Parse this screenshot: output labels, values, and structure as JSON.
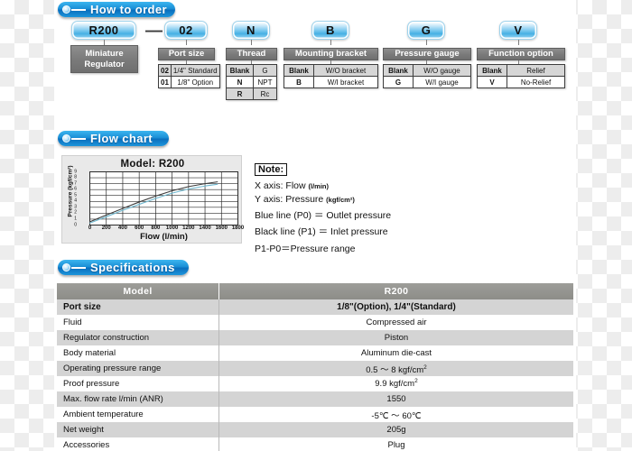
{
  "sections": {
    "how_to_order": "How to order",
    "flow_chart": "Flow chart",
    "specifications": "Specifications"
  },
  "order_code": {
    "pills": [
      {
        "label": "R200"
      },
      {
        "label": "02"
      },
      {
        "label": "N"
      },
      {
        "label": "B"
      },
      {
        "label": "G"
      },
      {
        "label": "V"
      }
    ],
    "separator": "—",
    "model_box": "Miniature\nRegulator",
    "model_box_line1": "Miniature",
    "model_box_line2": "Regulator",
    "groups": [
      {
        "title": "Port size",
        "rows": [
          {
            "code": "02",
            "desc": "1/4\" Standard"
          },
          {
            "code": "01",
            "desc": "1/8\" Option"
          }
        ]
      },
      {
        "title": "Thread",
        "rows": [
          {
            "code": "Blank",
            "desc": "G"
          },
          {
            "code": "N",
            "desc": "NPT"
          },
          {
            "code": "R",
            "desc": "Rc"
          }
        ]
      },
      {
        "title": "Mounting bracket",
        "rows": [
          {
            "code": "Blank",
            "desc": "W/O bracket"
          },
          {
            "code": "B",
            "desc": "W/I bracket"
          }
        ]
      },
      {
        "title": "Pressure gauge",
        "rows": [
          {
            "code": "Blank",
            "desc": "W/O gauge"
          },
          {
            "code": "G",
            "desc": "W/I gauge"
          }
        ]
      },
      {
        "title": "Function option",
        "rows": [
          {
            "code": "Blank",
            "desc": "Relief"
          },
          {
            "code": "V",
            "desc": "No-Relief"
          }
        ]
      }
    ]
  },
  "note": {
    "title": "Note:",
    "lines": [
      {
        "text": "X axis: Flow ",
        "unit": "(l/min)"
      },
      {
        "text": "Y axis: Pressure ",
        "unit": "(kgf/cm²)"
      },
      {
        "text": "Blue line (P0) ＝ Outlet pressure",
        "unit": ""
      },
      {
        "text": "Black line (P1) ＝ Inlet pressure",
        "unit": ""
      },
      {
        "text": "P1-P0＝Pressure range",
        "unit": ""
      }
    ]
  },
  "chart_data": {
    "type": "line",
    "title": "Model: R200",
    "xlabel": "Flow (l/min)",
    "ylabel": "Pressure (kgf/cm²)",
    "xlim": [
      0,
      1800
    ],
    "ylim": [
      0,
      9
    ],
    "xticks": [
      0,
      200,
      400,
      600,
      800,
      1000,
      1200,
      1400,
      1600,
      1800
    ],
    "yticks": [
      0,
      1,
      2,
      3,
      4,
      5,
      6,
      7,
      8,
      9
    ],
    "grid": true,
    "legend": "none",
    "series": [
      {
        "name": "Black line (P1) = Inlet pressure",
        "color": "#3c3c3c",
        "x": [
          0,
          200,
          400,
          600,
          800,
          1000,
          1200,
          1400,
          1550
        ],
        "y": [
          0.55,
          1.7,
          2.8,
          3.9,
          4.9,
          5.8,
          6.5,
          7.0,
          7.3
        ]
      },
      {
        "name": "Blue line (P0) = Outlet pressure",
        "color": "#6fb8cf",
        "x": [
          0,
          200,
          400,
          600,
          800,
          1000,
          1200,
          1400,
          1550
        ],
        "y": [
          0.35,
          1.4,
          2.5,
          3.5,
          4.5,
          5.4,
          6.1,
          6.6,
          6.9
        ]
      }
    ]
  },
  "specifications": {
    "columns": [
      "Model",
      "R200"
    ],
    "rows": [
      {
        "label": "Port size",
        "value": "1/8\"(Option), 1/4\"(Standard)",
        "bold": true
      },
      {
        "label": "Fluid",
        "value": "Compressed air",
        "bold": false
      },
      {
        "label": "Regulator construction",
        "value": "Piston",
        "bold": false
      },
      {
        "label": "Body material",
        "value": "Aluminum die-cast",
        "bold": false
      },
      {
        "label": "Operating pressure range",
        "value": "0.5 ～ 8 kgf/cm",
        "sup": "2",
        "bold": false
      },
      {
        "label": "Proof pressure",
        "value": "9.9 kgf/cm",
        "sup": "2",
        "bold": false
      },
      {
        "label": "Max. flow rate  l/min (ANR)",
        "value": "1550",
        "bold": false
      },
      {
        "label": "Ambient temperature",
        "value": "-5℃ ～ 60℃",
        "bold": false
      },
      {
        "label": "Net weight",
        "value": "205g",
        "bold": false
      },
      {
        "label": "Accessories",
        "value": "Plug",
        "bold": false
      }
    ]
  },
  "colors": {
    "accent_blue": "#1b8fd6",
    "pill_blue": "#47b0e4",
    "grey_box": "#7b7b7b",
    "table_head": "#8d8d88",
    "row_odd": "#d4d4d4",
    "chart_black_line": "#3c3c3c",
    "chart_blue_line": "#6fb8cf"
  }
}
